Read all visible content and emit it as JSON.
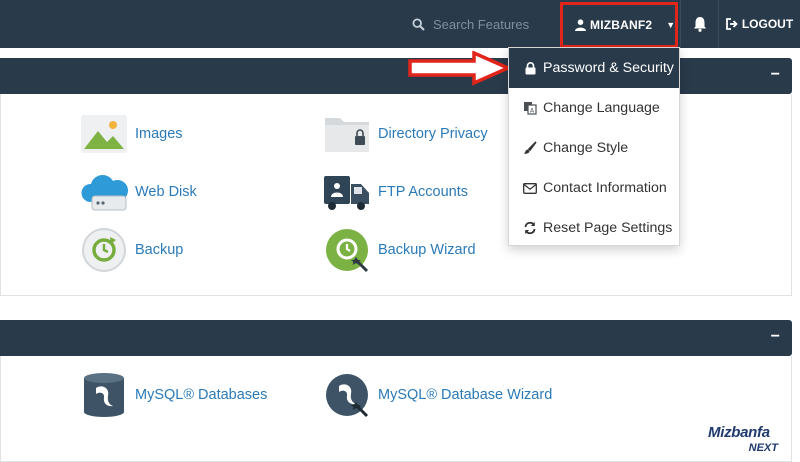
{
  "header": {
    "search_placeholder": "Search Features",
    "username": "MIZBANF2",
    "logout_label": "LOGOUT"
  },
  "panels": [
    {
      "toggle": "−",
      "items": [
        {
          "label": "Images",
          "icon": "images-icon"
        },
        {
          "label": "Directory Privacy",
          "icon": "folder-lock-icon"
        },
        {
          "label": "Web Disk",
          "icon": "cloud-disk-icon"
        },
        {
          "label": "FTP Accounts",
          "icon": "ftp-truck-icon"
        },
        {
          "label": "Backup",
          "icon": "backup-icon"
        },
        {
          "label": "Backup Wizard",
          "icon": "backup-wizard-icon"
        }
      ]
    },
    {
      "toggle": "−",
      "items": [
        {
          "label": "MySQL® Databases",
          "icon": "mysql-database-icon"
        },
        {
          "label": "MySQL® Database Wizard",
          "icon": "mysql-wizard-icon"
        }
      ]
    }
  ],
  "user_dropdown": {
    "items": [
      {
        "label": "Password & Security",
        "icon": "lock-icon",
        "active": true
      },
      {
        "label": "Change Language",
        "icon": "language-icon"
      },
      {
        "label": "Change Style",
        "icon": "brush-icon"
      },
      {
        "label": "Contact Information",
        "icon": "envelope-icon"
      },
      {
        "label": "Reset Page Settings",
        "icon": "refresh-icon"
      }
    ]
  },
  "watermark": {
    "brand": "Mizbanfa",
    "sub": "NEXT"
  },
  "colors": {
    "header_bg": "#293a4a",
    "link_blue": "#2a7ab8",
    "highlight_red": "#e1251b"
  }
}
